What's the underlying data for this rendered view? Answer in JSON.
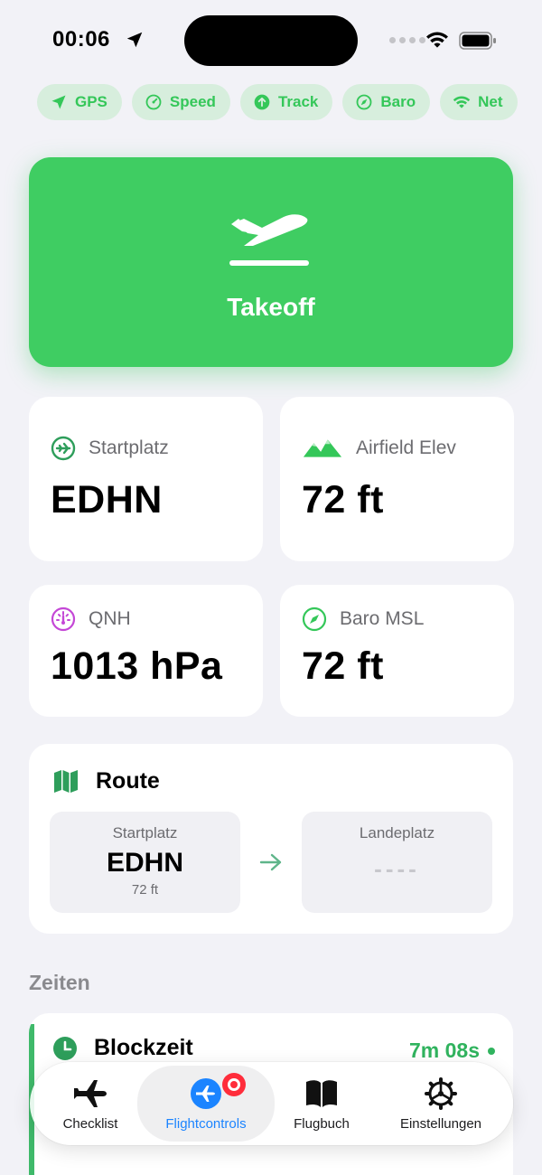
{
  "status_bar": {
    "time": "00:06"
  },
  "chips": [
    {
      "label": "GPS",
      "icon": "location-arrow-icon"
    },
    {
      "label": "Speed",
      "icon": "speedometer-icon"
    },
    {
      "label": "Track",
      "icon": "arrow-up-circle-icon"
    },
    {
      "label": "Baro",
      "icon": "compass-icon"
    },
    {
      "label": "Net",
      "icon": "wifi-icon"
    }
  ],
  "takeoff": {
    "label": "Takeoff",
    "icon": "airplane-departure-icon",
    "color": "#3fcd62"
  },
  "stats": [
    {
      "label": "Startplatz",
      "value": "EDHN",
      "icon": "airplane-circle-icon",
      "icon_color": "#2e9e5b"
    },
    {
      "label": "Airfield Elev",
      "value": "72 ft",
      "icon": "mountains-icon",
      "icon_color": "#34c759"
    },
    {
      "label": "QNH",
      "value": "1013 hPa",
      "icon": "gauge-icon",
      "icon_color": "#c447d6"
    },
    {
      "label": "Baro MSL",
      "value": "72 ft",
      "icon": "compass-icon",
      "icon_color": "#34c759"
    }
  ],
  "route": {
    "title": "Route",
    "from": {
      "label": "Startplatz",
      "code": "EDHN",
      "elevation": "72 ft"
    },
    "to": {
      "label": "Landeplatz",
      "code": "----"
    }
  },
  "zeiten": {
    "section_title": "Zeiten",
    "block_title": "Blockzeit",
    "block_time": "7m 08s"
  },
  "tabbar": {
    "tabs": [
      {
        "label": "Checklist",
        "icon": "airplane-icon"
      },
      {
        "label": "Flightcontrols",
        "icon": "airplane-circle-icon",
        "active": true
      },
      {
        "label": "Flugbuch",
        "icon": "book-icon"
      },
      {
        "label": "Einstellungen",
        "icon": "gear-icon"
      }
    ]
  },
  "colors": {
    "accent": "#34c759",
    "active_tab": "#1b84ff",
    "background": "#f2f2f7"
  }
}
